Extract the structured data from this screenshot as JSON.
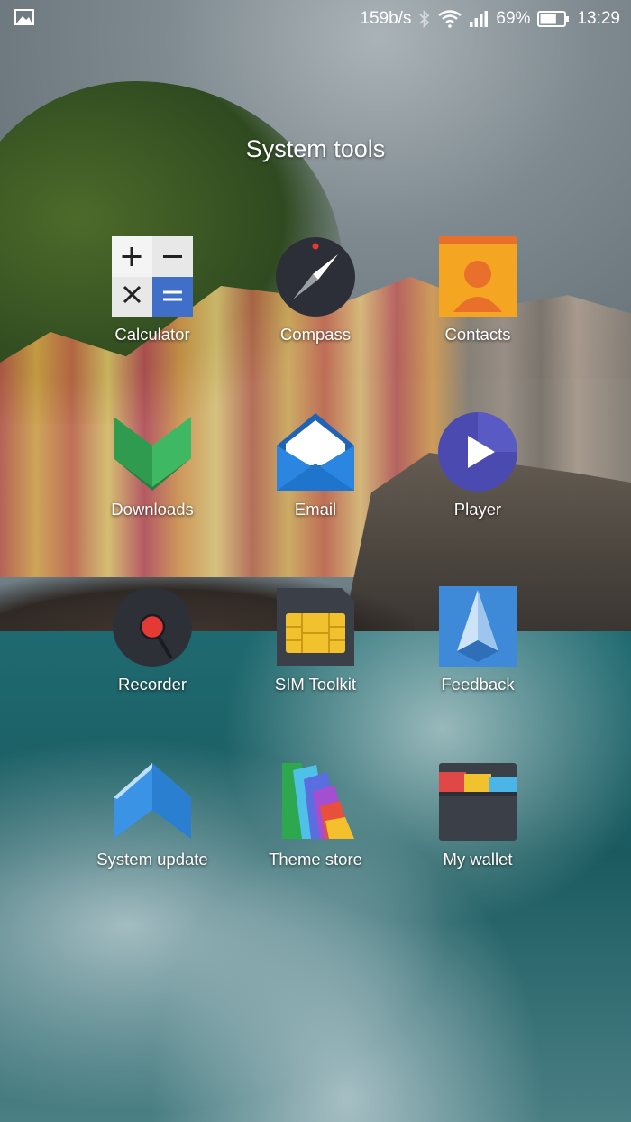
{
  "status_bar": {
    "left_icon": "image-notification-icon",
    "net_speed": "159b/s",
    "bluetooth_icon": "bluetooth-icon",
    "wifi_icon": "wifi-icon",
    "signal_icon": "cellular-signal-icon",
    "battery_percent": "69%",
    "battery_level": 0.69,
    "battery_icon": "battery-icon",
    "time": "13:29"
  },
  "folder": {
    "title": "System tools",
    "apps": [
      {
        "label": "Calculator",
        "icon": "calculator-icon"
      },
      {
        "label": "Compass",
        "icon": "compass-icon"
      },
      {
        "label": "Contacts",
        "icon": "contacts-icon"
      },
      {
        "label": "Downloads",
        "icon": "downloads-icon"
      },
      {
        "label": "Email",
        "icon": "email-icon"
      },
      {
        "label": "Player",
        "icon": "player-icon"
      },
      {
        "label": "Recorder",
        "icon": "recorder-icon"
      },
      {
        "label": "SIM Toolkit",
        "icon": "sim-toolkit-icon"
      },
      {
        "label": "Feedback",
        "icon": "feedback-icon"
      },
      {
        "label": "System update",
        "icon": "system-update-icon"
      },
      {
        "label": "Theme store",
        "icon": "theme-store-icon"
      },
      {
        "label": "My wallet",
        "icon": "wallet-icon"
      }
    ]
  }
}
